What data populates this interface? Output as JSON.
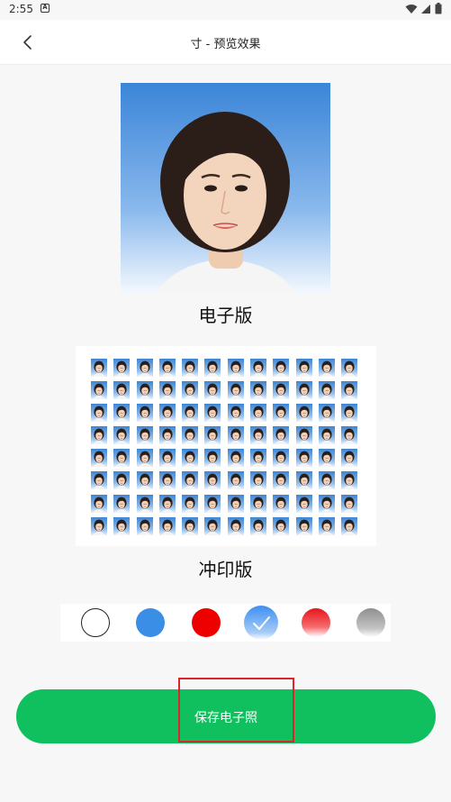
{
  "status_bar": {
    "time": "2:55",
    "notification_icon": "A",
    "icons": [
      "wifi-icon",
      "signal-icon",
      "battery-icon"
    ]
  },
  "appbar": {
    "title": "寸 - 预览效果",
    "back_icon": "chevron-left-icon"
  },
  "preview": {
    "electronic_label": "电子版",
    "print_label": "冲印版",
    "print_grid": {
      "rows": 8,
      "cols": 12
    }
  },
  "background_colors": [
    {
      "name": "white",
      "color": "#ffffff",
      "selected": false
    },
    {
      "name": "blue",
      "color": "#3a8ee6",
      "selected": false
    },
    {
      "name": "red",
      "color": "#ee0000",
      "selected": false
    },
    {
      "name": "blue-gradient",
      "color": "#4b9af0",
      "selected": true
    },
    {
      "name": "red-gradient",
      "color": "#e8141a",
      "selected": false
    },
    {
      "name": "gray-gradient",
      "color": "#9a9a9a",
      "selected": false
    }
  ],
  "actions": {
    "save_label": "保存电子照"
  },
  "colors": {
    "accent": "#10c05e",
    "highlight": "#d9262b"
  }
}
